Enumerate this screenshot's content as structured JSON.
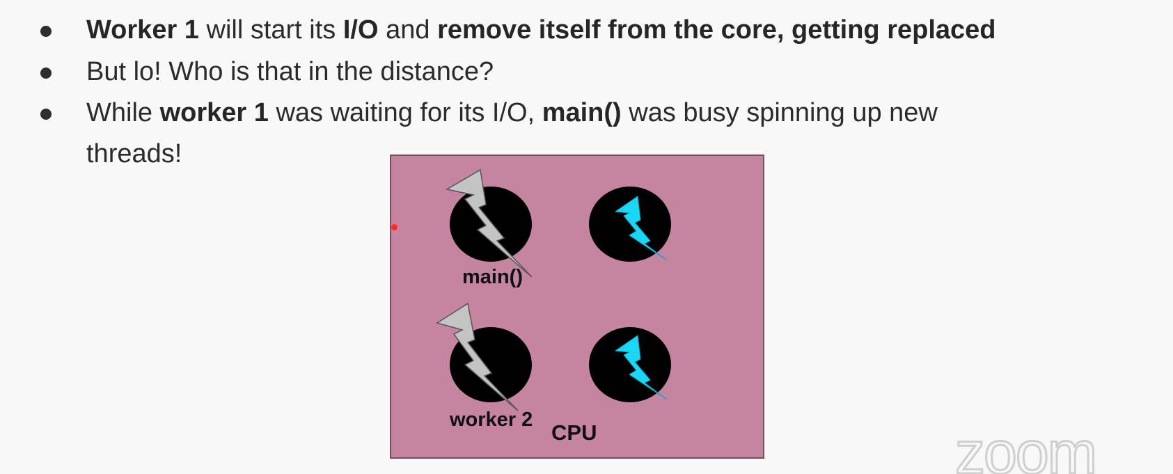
{
  "slide": {
    "bullets": [
      {
        "segments": [
          {
            "text": "Worker 1",
            "bold": true
          },
          {
            "text": " will start its ",
            "bold": false
          },
          {
            "text": "I/O",
            "bold": true
          },
          {
            "text": " and ",
            "bold": false
          },
          {
            "text": "remove itself from the core, getting replaced",
            "bold": true
          }
        ]
      },
      {
        "segments": [
          {
            "text": "But lo! Who is that in the distance?",
            "bold": false
          }
        ]
      },
      {
        "segments": [
          {
            "text": "While ",
            "bold": false
          },
          {
            "text": "worker 1",
            "bold": true
          },
          {
            "text": " was waiting for its I/O, ",
            "bold": false
          },
          {
            "text": "main()",
            "bold": true
          },
          {
            "text": " was busy spinning up new",
            "bold": false
          }
        ],
        "continuation": "threads!"
      }
    ]
  },
  "diagram": {
    "box_color": "#c5849f",
    "core_color": "#000000",
    "active_bolt_color": "#1ad8f5",
    "thread_bolt_color": "#c4c4c4",
    "cpu_label": "CPU",
    "labels": {
      "main": "main()",
      "worker2": "worker 2"
    }
  },
  "watermark": {
    "text": "zoom",
    "icon": "zoom-logo"
  }
}
